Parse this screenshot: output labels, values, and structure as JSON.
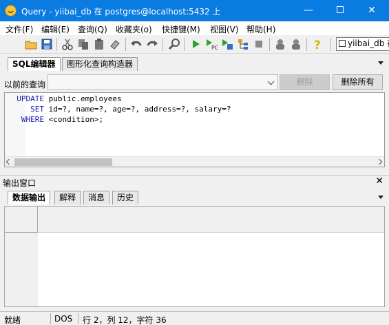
{
  "window": {
    "title": "Query - yiibai_db 在  postgres@localhost:5432 上",
    "minimize_glyph": "—",
    "close_glyph": "✕"
  },
  "menu": [
    "文件(F)",
    "编辑(E)",
    "查询(Q)",
    "收藏夹(o)",
    "快捷键(M)",
    "视图(V)",
    "帮助(H)"
  ],
  "toolbar": {
    "icons": [
      "open-folder-icon",
      "save-icon",
      "cut-icon",
      "copy-icon",
      "paste-icon",
      "eraser-icon",
      "undo-icon",
      "redo-icon",
      "find-icon",
      "execute-icon",
      "execute-pgscript-icon",
      "execute-to-file-icon",
      "explain-icon",
      "stop-icon",
      "explain-options-icon",
      "commit-icon",
      "help-icon"
    ],
    "database_select": "yiibai_db 在"
  },
  "editor_tabs": [
    "SQL编辑器",
    "图形化查询构造器"
  ],
  "previous_queries": {
    "label": "以前的查询",
    "delete_button": "删除",
    "delete_all_button": "删除所有"
  },
  "editor": {
    "lines": [
      [
        "  ",
        "UPDATE",
        " public.employees"
      ],
      [
        "     ",
        "SET",
        " id=?, name=?, age=?, address=?, salary=?"
      ],
      [
        "   ",
        "WHERE",
        " <condition>;"
      ]
    ]
  },
  "output": {
    "title": "输出窗口",
    "close_glyph": "✕",
    "tabs": [
      "数据输出",
      "解释",
      "消息",
      "历史"
    ]
  },
  "status": {
    "state": "就绪",
    "encoding": "DOS",
    "position": "行 2，列 12，字符 36"
  },
  "colors": {
    "titlebar": "#0a7be0",
    "keyword": "#1a1aa6"
  }
}
